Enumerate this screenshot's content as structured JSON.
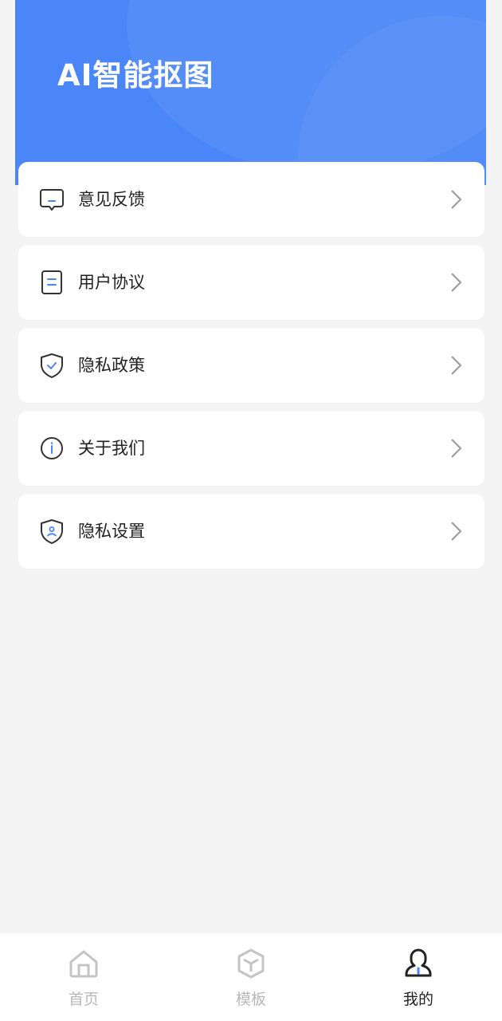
{
  "header": {
    "title": "AI智能抠图"
  },
  "menu": {
    "items": [
      {
        "label": "意见反馈",
        "icon": "feedback-icon"
      },
      {
        "label": "用户协议",
        "icon": "document-icon"
      },
      {
        "label": "隐私政策",
        "icon": "shield-check-icon"
      },
      {
        "label": "关于我们",
        "icon": "info-icon"
      },
      {
        "label": "隐私设置",
        "icon": "shield-user-icon"
      }
    ]
  },
  "tabbar": {
    "tabs": [
      {
        "label": "首页",
        "icon": "home-icon",
        "active": false
      },
      {
        "label": "模板",
        "icon": "cube-icon",
        "active": false
      },
      {
        "label": "我的",
        "icon": "user-icon",
        "active": true
      }
    ]
  },
  "colors": {
    "accent": "#4a86f7",
    "background": "#f4f4f4",
    "icon_stroke": "#333333",
    "tab_inactive": "#b8b8b8"
  }
}
